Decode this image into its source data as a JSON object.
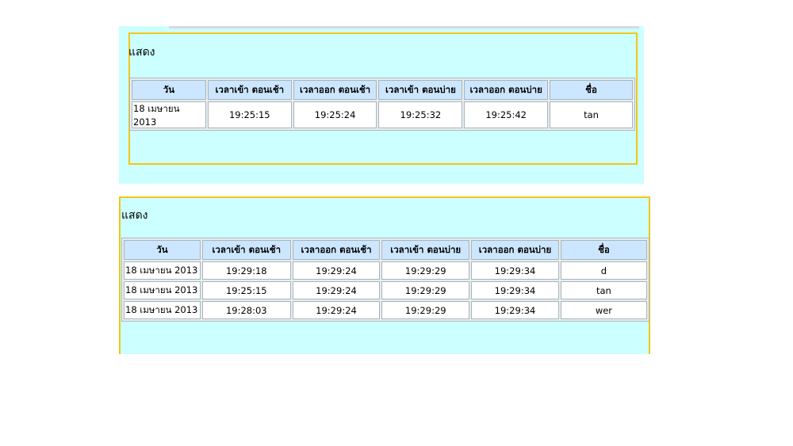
{
  "panels": [
    {
      "title": "แสดง",
      "headers": [
        "วัน",
        "เวลาเข้า ตอนเช้า",
        "เวลาออก ตอนเช้า",
        "เวลาเข้า ตอนบ่าย",
        "เวลาออก ตอนบ่าย",
        "ชื่อ"
      ],
      "rows": [
        [
          "18 เมษายน 2013",
          "19:25:15",
          "19:25:24",
          "19:25:32",
          "19:25:42",
          "tan"
        ]
      ]
    },
    {
      "title": "แสดง",
      "headers": [
        "วัน",
        "เวลาเข้า ตอนเช้า",
        "เวลาออก ตอนเช้า",
        "เวลาเข้า ตอนบ่าย",
        "เวลาออก ตอนบ่าย",
        "ชื่อ"
      ],
      "rows": [
        [
          "18 เมษายน 2013",
          "19:29:18",
          "19:29:24",
          "19:29:29",
          "19:29:34",
          "d"
        ],
        [
          "18 เมษายน 2013",
          "19:25:15",
          "19:29:24",
          "19:29:29",
          "19:29:34",
          "tan"
        ],
        [
          "18 เมษายน 2013",
          "19:28:03",
          "19:29:24",
          "19:29:29",
          "19:29:34",
          "wer"
        ]
      ]
    }
  ],
  "colors": {
    "panel_bg": "#ccffff",
    "frame": "#f5c518",
    "header_bg": "#cce6ff"
  }
}
